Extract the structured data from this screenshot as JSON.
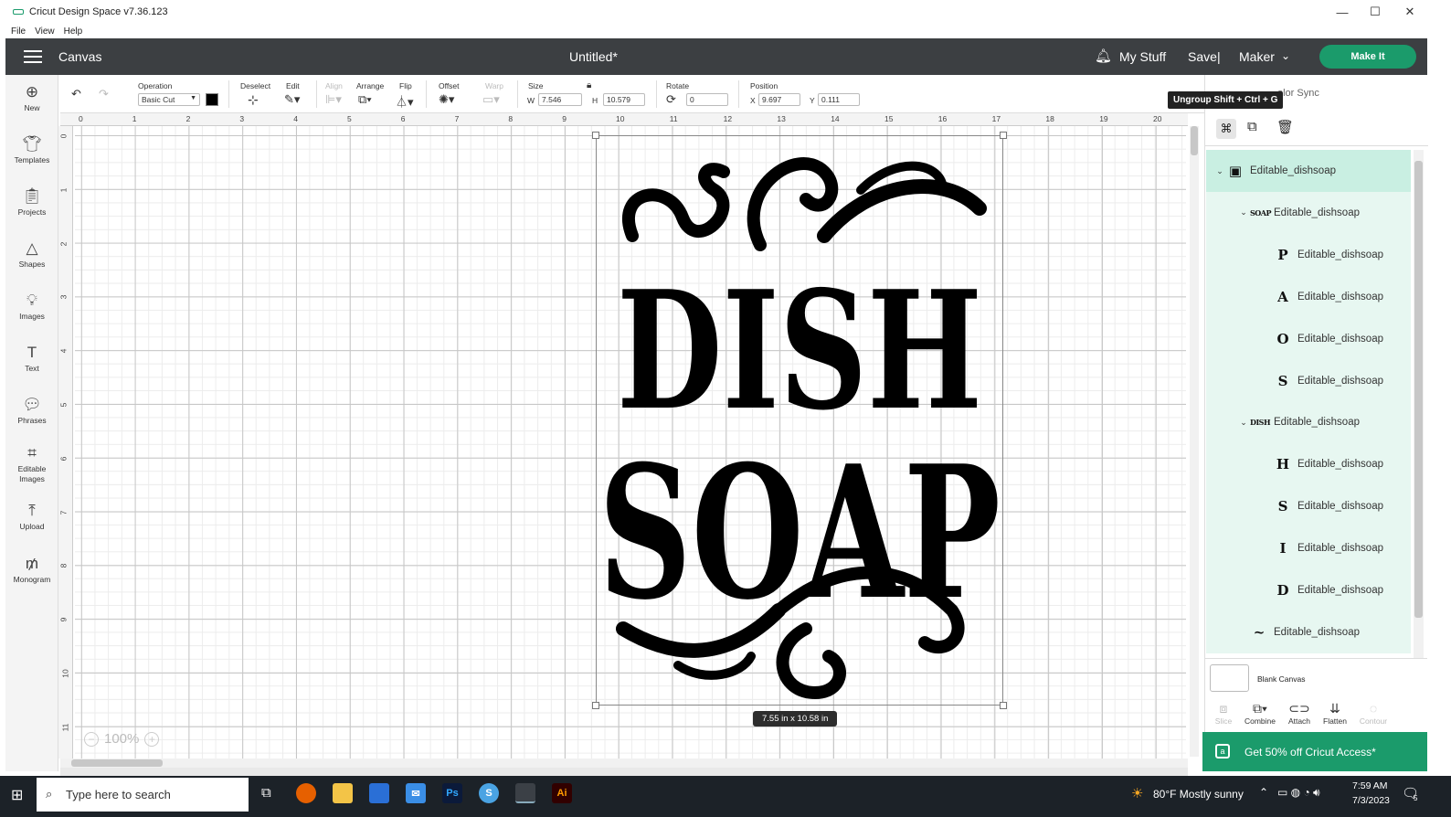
{
  "window": {
    "title": "Cricut Design Space  v7.36.123",
    "menu": [
      "File",
      "View",
      "Help"
    ]
  },
  "header": {
    "canvas_label": "Canvas",
    "doc_title": "Untitled*",
    "my_stuff": "My Stuff",
    "save": "Save",
    "separator": "|",
    "machine": "Maker",
    "make_it": "Make It"
  },
  "toolbar": {
    "operation_label": "Operation",
    "operation_value": "Basic Cut",
    "deselect": "Deselect",
    "edit": "Edit",
    "align": "Align",
    "arrange": "Arrange",
    "flip": "Flip",
    "offset": "Offset",
    "warp": "Warp",
    "size_label": "Size",
    "w_label": "W",
    "w_value": "7.546",
    "h_label": "H",
    "h_value": "10.579",
    "rotate_label": "Rotate",
    "rotate_value": "0",
    "position_label": "Position",
    "x_label": "X",
    "x_value": "9.697",
    "y_label": "Y",
    "y_value": "0.111"
  },
  "sidebar": [
    {
      "label": "New",
      "icon": "new-icon"
    },
    {
      "label": "Templates",
      "icon": "templates-icon"
    },
    {
      "label": "Projects",
      "icon": "projects-icon"
    },
    {
      "label": "Shapes",
      "icon": "shapes-icon"
    },
    {
      "label": "Images",
      "icon": "images-icon"
    },
    {
      "label": "Text",
      "icon": "text-icon"
    },
    {
      "label": "Phrases",
      "icon": "phrases-icon"
    },
    {
      "label": "Editable Images",
      "icon": "editable-images-icon"
    },
    {
      "label": "Upload",
      "icon": "upload-icon"
    },
    {
      "label": "Monogram",
      "icon": "monogram-icon"
    }
  ],
  "ruler": {
    "h": [
      "0",
      "1",
      "2",
      "3",
      "4",
      "5",
      "6",
      "7",
      "8",
      "9",
      "10",
      "11",
      "12",
      "13",
      "14",
      "15",
      "16",
      "17",
      "18",
      "19",
      "20"
    ],
    "v": [
      "0",
      "1",
      "2",
      "3",
      "4",
      "5",
      "6",
      "7",
      "8",
      "9",
      "10",
      "11"
    ]
  },
  "canvas": {
    "art_line1": "DISH",
    "art_line2": "SOAP",
    "size_badge": "7.55  in x 10.58  in",
    "zoom": "100%"
  },
  "panel": {
    "tooltip": "Ungroup Shift + Ctrl + G",
    "tab_text": "olor Sync",
    "layers": [
      {
        "label": "Editable_dishsoap",
        "thumb": "▣",
        "level": 0,
        "chev": "⌄",
        "selected": true
      },
      {
        "label": "Editable_dishsoap",
        "thumb": "SOAP",
        "level": 1,
        "chev": "⌄"
      },
      {
        "label": "Editable_dishsoap",
        "thumb": "P",
        "level": 2,
        "chev": ""
      },
      {
        "label": "Editable_dishsoap",
        "thumb": "A",
        "level": 2,
        "chev": ""
      },
      {
        "label": "Editable_dishsoap",
        "thumb": "O",
        "level": 2,
        "chev": ""
      },
      {
        "label": "Editable_dishsoap",
        "thumb": "S",
        "level": 2,
        "chev": ""
      },
      {
        "label": "Editable_dishsoap",
        "thumb": "DISH",
        "level": 1,
        "chev": "⌄"
      },
      {
        "label": "Editable_dishsoap",
        "thumb": "H",
        "level": 2,
        "chev": ""
      },
      {
        "label": "Editable_dishsoap",
        "thumb": "S",
        "level": 2,
        "chev": ""
      },
      {
        "label": "Editable_dishsoap",
        "thumb": "I",
        "level": 2,
        "chev": ""
      },
      {
        "label": "Editable_dishsoap",
        "thumb": "D",
        "level": 2,
        "chev": ""
      },
      {
        "label": "Editable_dishsoap",
        "thumb": "~",
        "level": 1,
        "chev": ""
      }
    ],
    "blank_canvas": "Blank Canvas",
    "tools": [
      "Slice",
      "Combine",
      "Attach",
      "Flatten",
      "Contour"
    ],
    "promo": "Get 50% off Cricut Access*"
  },
  "taskbar": {
    "search_placeholder": "Type here to search",
    "weather": "80°F  Mostly sunny",
    "time": "7:59 AM",
    "date": "7/3/2023",
    "notif_count": "5"
  },
  "colors": {
    "header": "#3c3f42",
    "accent": "#1b9b6b",
    "selected_layer": "#c9efe2",
    "layer_bg": "#e7f7f1"
  }
}
